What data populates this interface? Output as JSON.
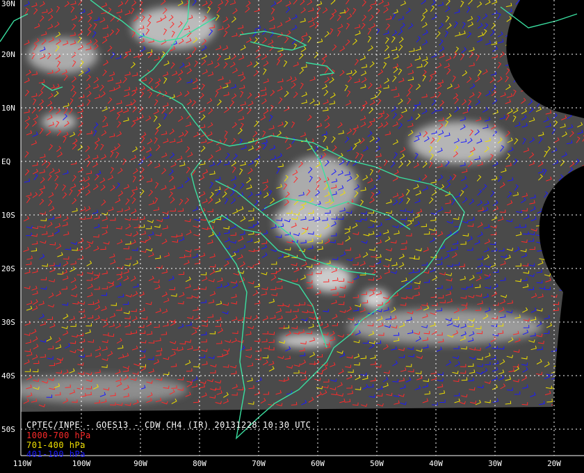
{
  "title": "CPTEC/INPE - GOES13 - CDW CH4 (IR) 20131228 10:30 UTC",
  "legend": [
    {
      "label": "1000-700 hPa",
      "color": "#ff2a2a"
    },
    {
      "label": "701-400 hPa",
      "color": "#f0e000"
    },
    {
      "label": "401-100 hPa",
      "color": "#1a1aff"
    }
  ],
  "lat_labels": [
    "30N",
    "20N",
    "10N",
    "EQ",
    "10S",
    "20S",
    "30S",
    "40S",
    "50S"
  ],
  "lon_labels": [
    "110W",
    "100W",
    "90W",
    "80W",
    "70W",
    "60W",
    "50W",
    "40W",
    "30W",
    "20W"
  ],
  "colors": {
    "background": "#000000",
    "coastline": "#3adfa0",
    "grid": "#ffffff",
    "satellite_base": "#4a4a4a"
  }
}
